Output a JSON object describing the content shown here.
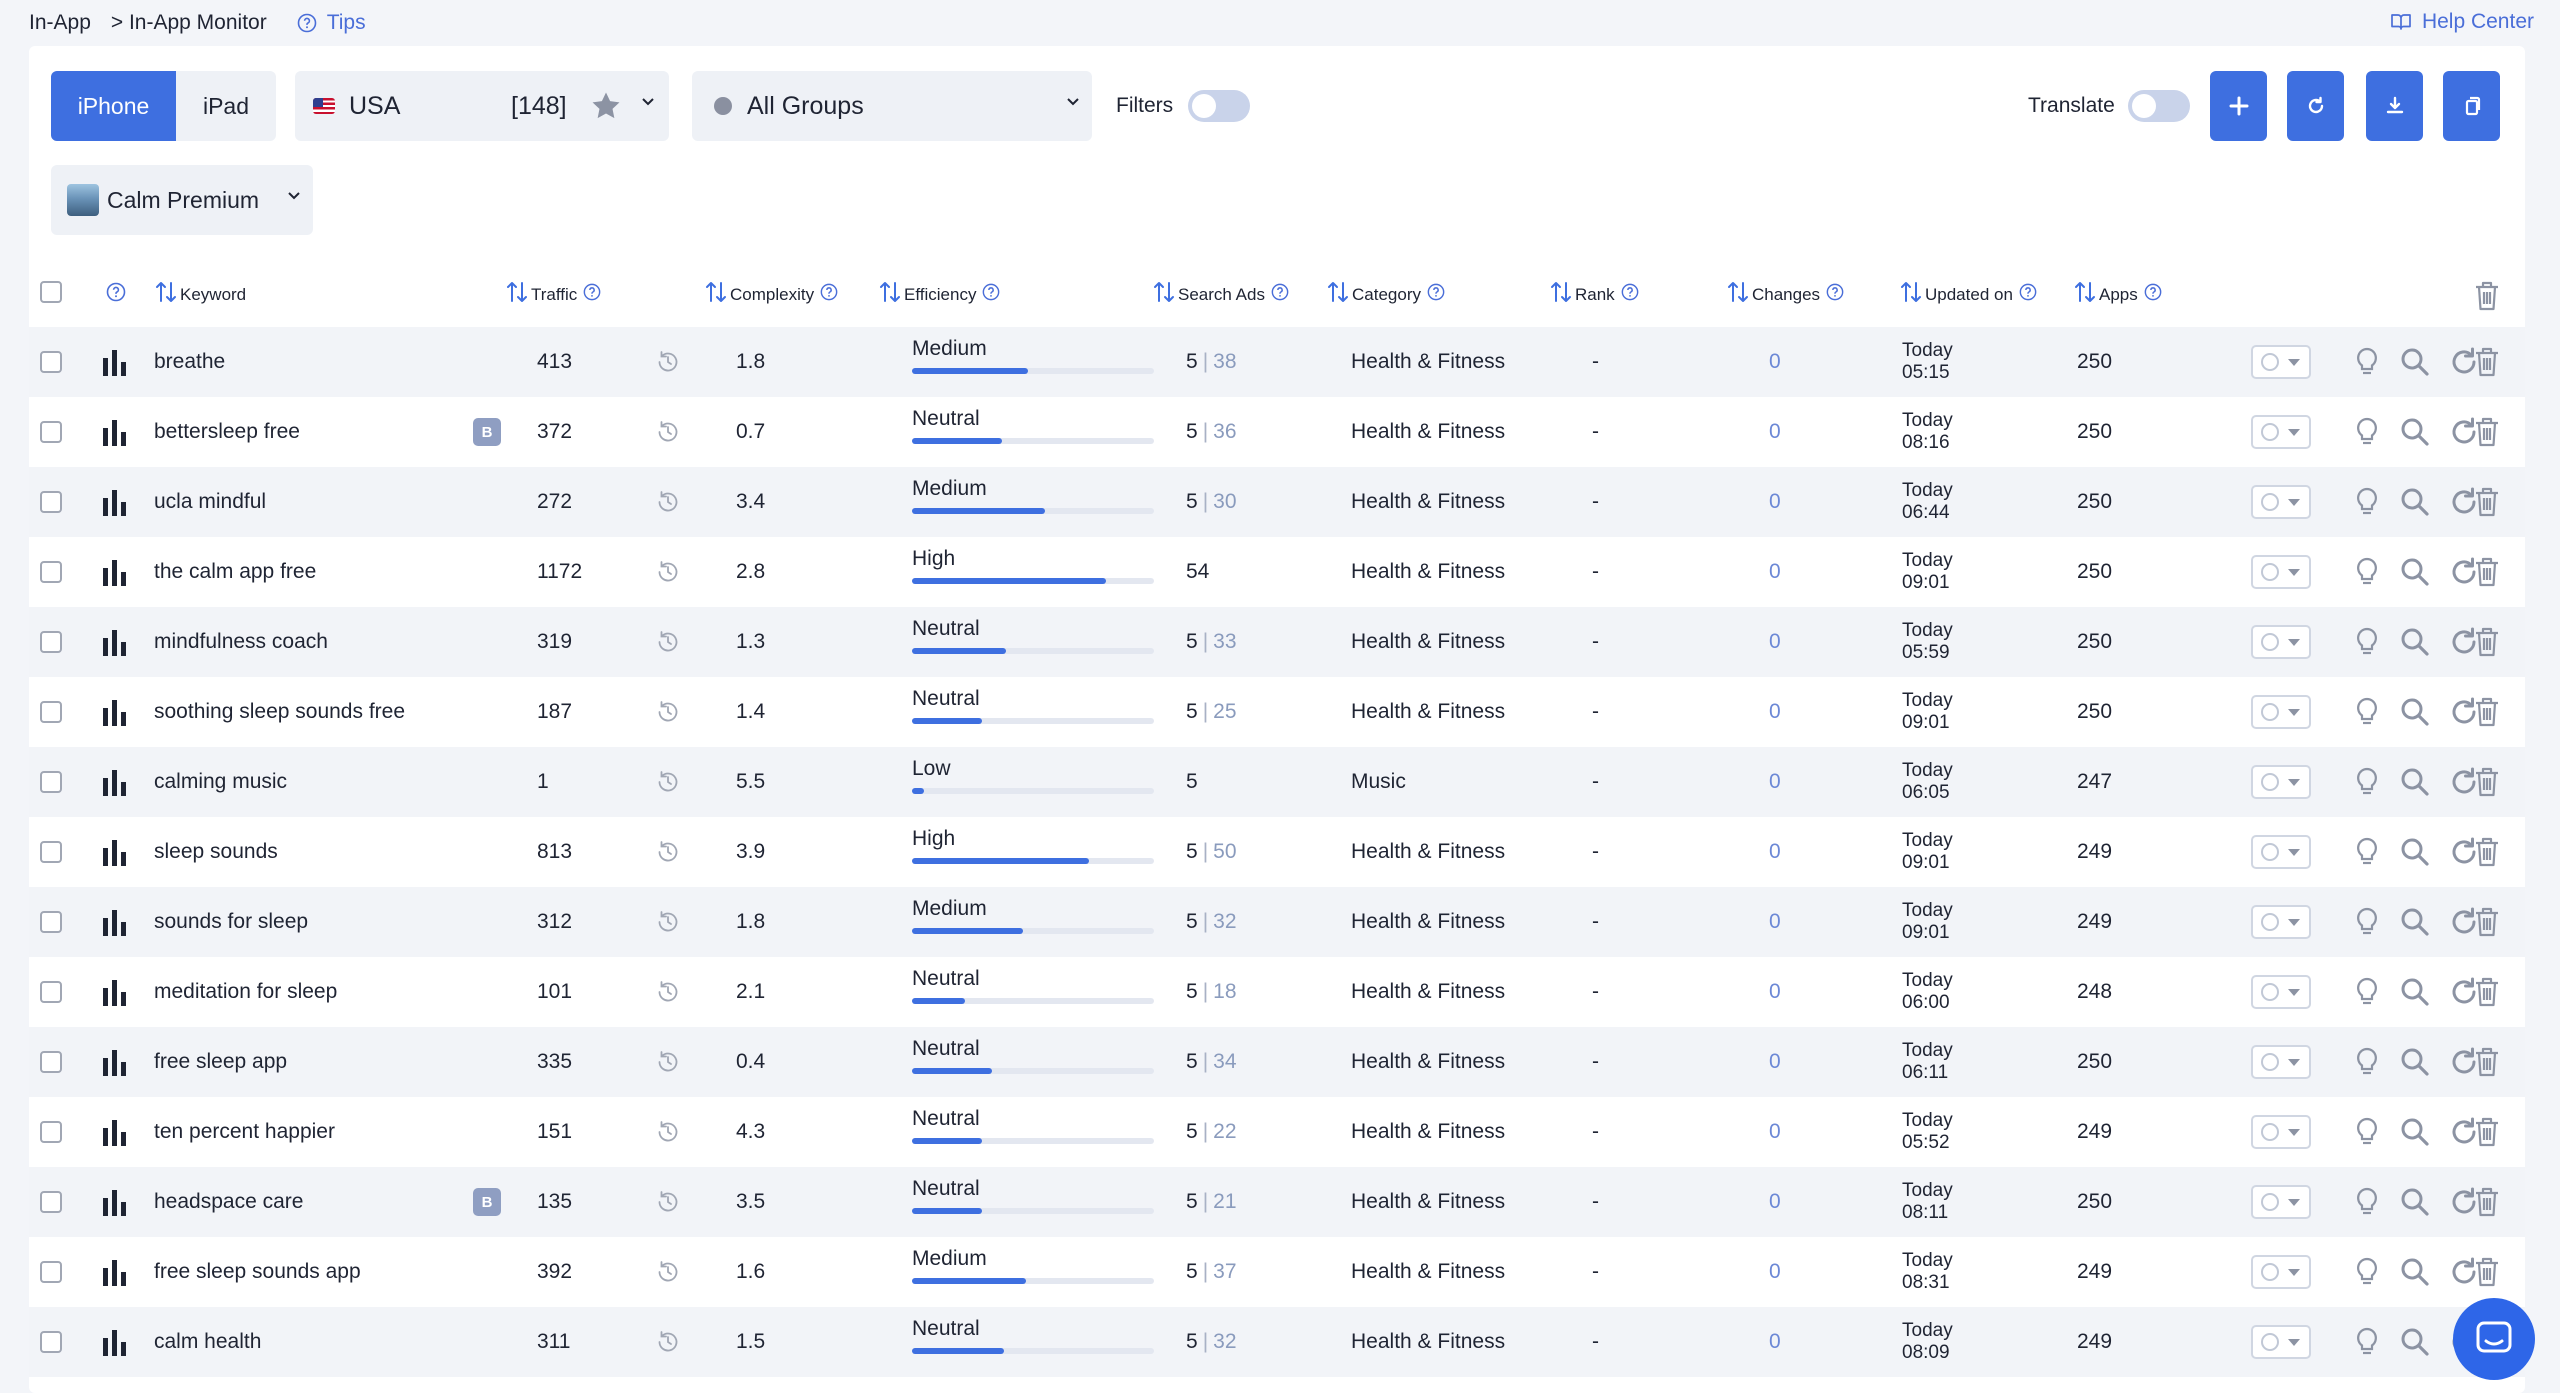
{
  "breadcrumb": {
    "root": "In-App",
    "current": "> In-App Monitor",
    "tips": "Tips",
    "help_center": "Help Center"
  },
  "toolbar": {
    "device_tabs": [
      "iPhone",
      "iPad"
    ],
    "active_device": "iPhone",
    "country": "USA",
    "country_count": "[148]",
    "group": "All Groups",
    "filters_label": "Filters",
    "translate_label": "Translate",
    "app_name": "Calm Premium"
  },
  "columns": [
    "Keyword",
    "Traffic",
    "Complexity",
    "Efficiency",
    "Search Ads",
    "Category",
    "Rank",
    "Changes",
    "Updated on",
    "Apps"
  ],
  "rows": [
    {
      "keyword": "breathe",
      "badge": "",
      "traffic": "413",
      "complexity": "1.8",
      "efficiency": "Medium",
      "eff_level": 0.48,
      "ads_a": "5",
      "ads_b": "38",
      "category": "Health & Fitness",
      "rank": "-",
      "changes": "0",
      "upd_day": "Today",
      "upd_time": "05:15",
      "apps": "250"
    },
    {
      "keyword": "bettersleep free",
      "badge": "B",
      "traffic": "372",
      "complexity": "0.7",
      "efficiency": "Neutral",
      "eff_level": 0.37,
      "ads_a": "5",
      "ads_b": "36",
      "category": "Health & Fitness",
      "rank": "-",
      "changes": "0",
      "upd_day": "Today",
      "upd_time": "08:16",
      "apps": "250"
    },
    {
      "keyword": "ucla mindful",
      "badge": "",
      "traffic": "272",
      "complexity": "3.4",
      "efficiency": "Medium",
      "eff_level": 0.55,
      "ads_a": "5",
      "ads_b": "30",
      "category": "Health & Fitness",
      "rank": "-",
      "changes": "0",
      "upd_day": "Today",
      "upd_time": "06:44",
      "apps": "250"
    },
    {
      "keyword": "the calm app free",
      "badge": "",
      "traffic": "1172",
      "complexity": "2.8",
      "efficiency": "High",
      "eff_level": 0.8,
      "ads_a": "54",
      "ads_b": "",
      "category": "Health & Fitness",
      "rank": "-",
      "changes": "0",
      "upd_day": "Today",
      "upd_time": "09:01",
      "apps": "250"
    },
    {
      "keyword": "mindfulness coach",
      "badge": "",
      "traffic": "319",
      "complexity": "1.3",
      "efficiency": "Neutral",
      "eff_level": 0.39,
      "ads_a": "5",
      "ads_b": "33",
      "category": "Health & Fitness",
      "rank": "-",
      "changes": "0",
      "upd_day": "Today",
      "upd_time": "05:59",
      "apps": "250"
    },
    {
      "keyword": "soothing sleep sounds free",
      "badge": "",
      "traffic": "187",
      "complexity": "1.4",
      "efficiency": "Neutral",
      "eff_level": 0.29,
      "ads_a": "5",
      "ads_b": "25",
      "category": "Health & Fitness",
      "rank": "-",
      "changes": "0",
      "upd_day": "Today",
      "upd_time": "09:01",
      "apps": "250"
    },
    {
      "keyword": "calming music",
      "badge": "",
      "traffic": "1",
      "complexity": "5.5",
      "efficiency": "Low",
      "eff_level": 0.05,
      "ads_a": "5",
      "ads_b": "",
      "category": "Music",
      "rank": "-",
      "changes": "0",
      "upd_day": "Today",
      "upd_time": "06:05",
      "apps": "247"
    },
    {
      "keyword": "sleep sounds",
      "badge": "",
      "traffic": "813",
      "complexity": "3.9",
      "efficiency": "High",
      "eff_level": 0.73,
      "ads_a": "5",
      "ads_b": "50",
      "category": "Health & Fitness",
      "rank": "-",
      "changes": "0",
      "upd_day": "Today",
      "upd_time": "09:01",
      "apps": "249"
    },
    {
      "keyword": "sounds for sleep",
      "badge": "",
      "traffic": "312",
      "complexity": "1.8",
      "efficiency": "Medium",
      "eff_level": 0.46,
      "ads_a": "5",
      "ads_b": "32",
      "category": "Health & Fitness",
      "rank": "-",
      "changes": "0",
      "upd_day": "Today",
      "upd_time": "09:01",
      "apps": "249"
    },
    {
      "keyword": "meditation for sleep",
      "badge": "",
      "traffic": "101",
      "complexity": "2.1",
      "efficiency": "Neutral",
      "eff_level": 0.22,
      "ads_a": "5",
      "ads_b": "18",
      "category": "Health & Fitness",
      "rank": "-",
      "changes": "0",
      "upd_day": "Today",
      "upd_time": "06:00",
      "apps": "248"
    },
    {
      "keyword": "free sleep app",
      "badge": "",
      "traffic": "335",
      "complexity": "0.4",
      "efficiency": "Neutral",
      "eff_level": 0.33,
      "ads_a": "5",
      "ads_b": "34",
      "category": "Health & Fitness",
      "rank": "-",
      "changes": "0",
      "upd_day": "Today",
      "upd_time": "06:11",
      "apps": "250"
    },
    {
      "keyword": "ten percent happier",
      "badge": "",
      "traffic": "151",
      "complexity": "4.3",
      "efficiency": "Neutral",
      "eff_level": 0.29,
      "ads_a": "5",
      "ads_b": "22",
      "category": "Health & Fitness",
      "rank": "-",
      "changes": "0",
      "upd_day": "Today",
      "upd_time": "05:52",
      "apps": "249"
    },
    {
      "keyword": "headspace care",
      "badge": "B",
      "traffic": "135",
      "complexity": "3.5",
      "efficiency": "Neutral",
      "eff_level": 0.29,
      "ads_a": "5",
      "ads_b": "21",
      "category": "Health & Fitness",
      "rank": "-",
      "changes": "0",
      "upd_day": "Today",
      "upd_time": "08:11",
      "apps": "250"
    },
    {
      "keyword": "free sleep sounds app",
      "badge": "",
      "traffic": "392",
      "complexity": "1.6",
      "efficiency": "Medium",
      "eff_level": 0.47,
      "ads_a": "5",
      "ads_b": "37",
      "category": "Health & Fitness",
      "rank": "-",
      "changes": "0",
      "upd_day": "Today",
      "upd_time": "08:31",
      "apps": "249"
    },
    {
      "keyword": "calm health",
      "badge": "",
      "traffic": "311",
      "complexity": "1.5",
      "efficiency": "Neutral",
      "eff_level": 0.38,
      "ads_a": "5",
      "ads_b": "32",
      "category": "Health & Fitness",
      "rank": "-",
      "changes": "0",
      "upd_day": "Today",
      "upd_time": "08:09",
      "apps": "249"
    }
  ],
  "colors": {
    "accent": "#3e6fe0",
    "row_alt": "#f2f4f8",
    "icon_gray": "#8c93a3"
  }
}
